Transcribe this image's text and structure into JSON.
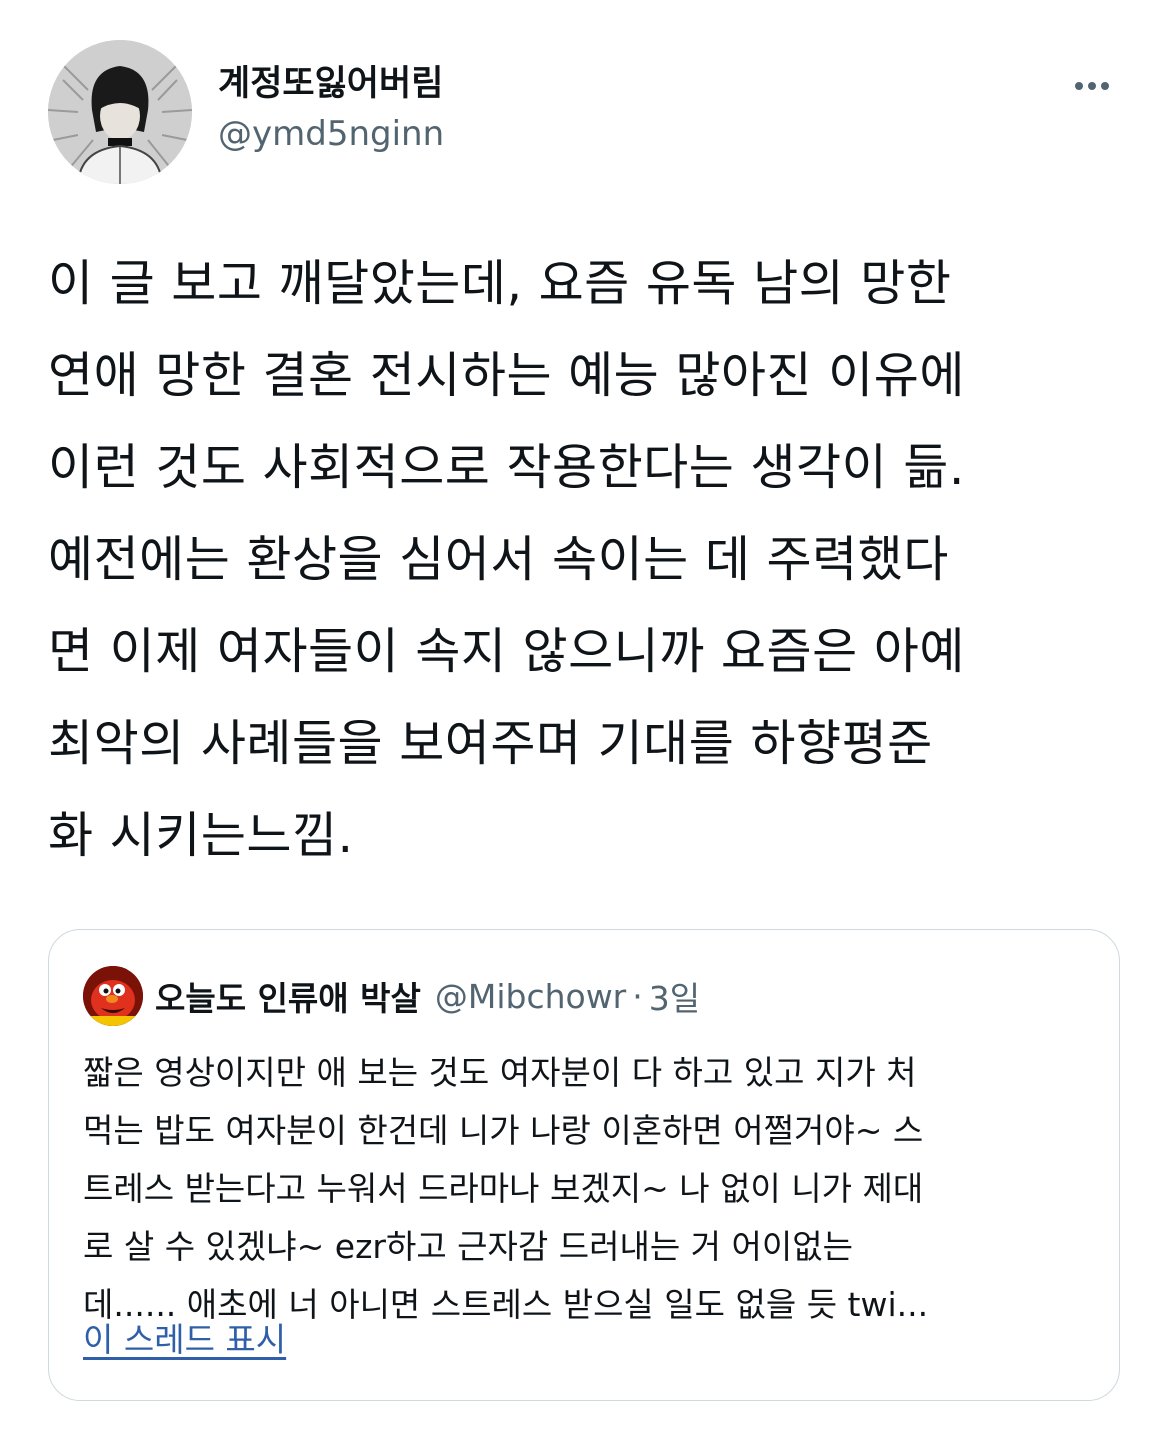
{
  "author": {
    "display_name": "계정또잃어버림",
    "handle": "@ymd5nginn"
  },
  "more_icon": "more-horizontal-icon",
  "tweet": {
    "lines": [
      "이 글 보고 깨달았는데, 요즘 유독 남의 망한",
      "연애 망한 결혼 전시하는 예능 많아진 이유에",
      "이런 것도 사회적으로 작용한다는 생각이 듦.",
      "예전에는 환상을 심어서 속이는 데 주력했다",
      "면 이제 여자들이 속지 않으니까 요즘은 아예",
      "최악의 사례들을 보여주며 기대를 하향평준",
      "화 시키는느낌."
    ]
  },
  "quote": {
    "display_name": "오늘도 인류애 박살",
    "handle": "@Mibchowr",
    "separator": "·",
    "time": "3일",
    "lines": [
      "짧은 영상이지만 애 보는 것도 여자분이 다 하고 있고 지가 처",
      "먹는 밥도 여자분이 한건데 니가 나랑 이혼하면 어쩔거야~ 스",
      "트레스 받는다고 누워서 드라마나 보겠지~ 나 없이 니가 제대",
      "로 살 수 있겠냐~ ezr하고 근자감 드러내는 거 어이없는",
      "데...... 애초에 너 아니면 스트레스 받으실 일도 없을 듯 twi..."
    ],
    "show_thread": "이 스레드 표시"
  },
  "colors": {
    "text": "#0f1419",
    "secondary": "#536471",
    "border": "#cfd9de",
    "link": "#2f5fa8"
  }
}
